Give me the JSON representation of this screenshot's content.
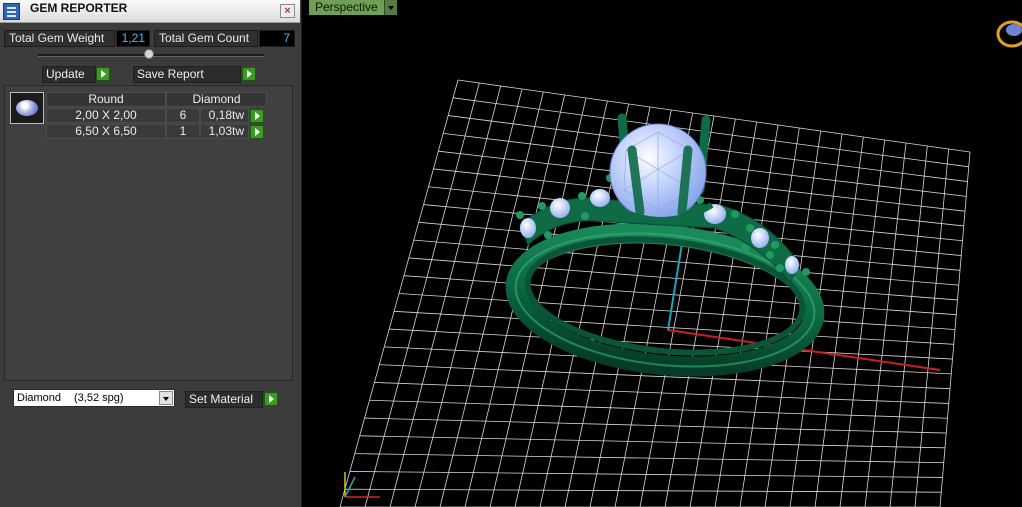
{
  "window": {
    "title": "GEM REPORTER",
    "close_glyph": "×"
  },
  "stats": {
    "weight_label": "Total Gem Weight",
    "weight_value": "1,21",
    "count_label": "Total Gem Count",
    "count_value": "7"
  },
  "actions": {
    "update_label": "Update",
    "save_report_label": "Save Report"
  },
  "gem_table": {
    "shape_header": "Round",
    "material_header": "Diamond",
    "rows": [
      {
        "size": "2,00 X 2,00",
        "count": "6",
        "weight": "0,18tw"
      },
      {
        "size": "6,50 X 6,50",
        "count": "1",
        "weight": "1,03tw"
      }
    ]
  },
  "material": {
    "selected_name": "Diamond",
    "selected_density": "(3,52 spg)",
    "set_label": "Set Material"
  },
  "viewport": {
    "mode_label": "Perspective"
  },
  "colors": {
    "accent_green": "#3b9a22",
    "ring_green": "#0e6b45",
    "gem_blue": "#a9c4ff",
    "value_cyan": "#39c0ff"
  },
  "icons": [
    "gem-reporter-app-icon",
    "close-icon",
    "slider-thumb-icon",
    "play-arrow-icon",
    "gem-thumbnail-icon",
    "dropdown-arrow-icon",
    "axis-gizmo-icon",
    "view-cube-icon"
  ]
}
